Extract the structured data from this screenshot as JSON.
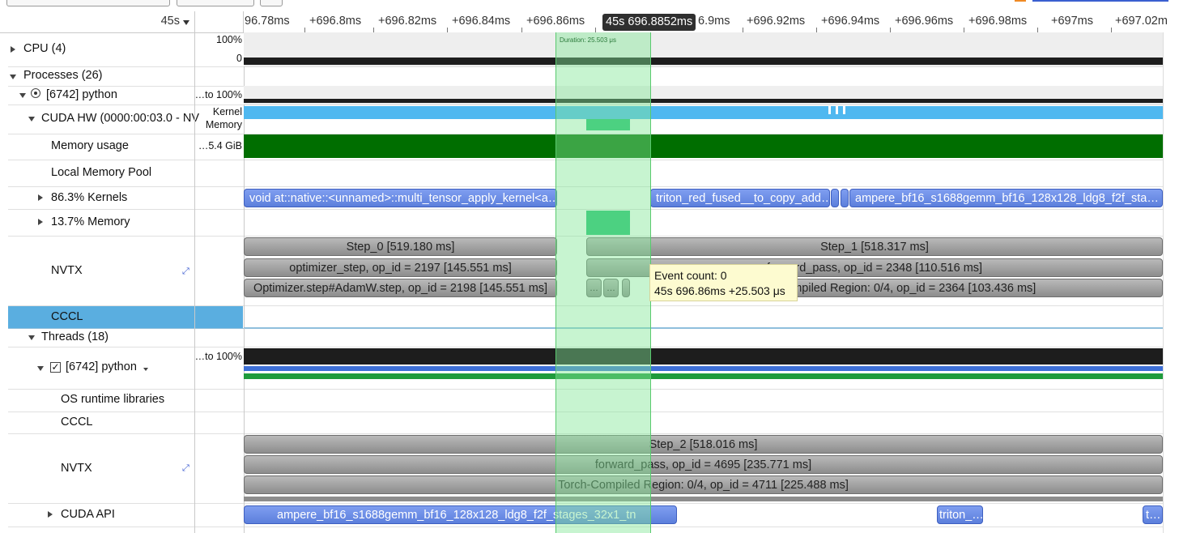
{
  "ruler": {
    "zoom_label": "45s",
    "ticks": [
      "96.78ms",
      "+696.8ms",
      "+696.82ms",
      "+696.84ms",
      "+696.86ms",
      "6.9ms",
      "+696.92ms",
      "+696.94ms",
      "+696.96ms",
      "+696.98ms",
      "+697ms",
      "+697.02m"
    ],
    "cursor_label": "45s 696.8852ms"
  },
  "selection": {
    "duration_label": "Duration: 25.503 μs"
  },
  "tree": {
    "cpu": {
      "label": "CPU (4)",
      "value_top": "100%",
      "value_bottom": "0"
    },
    "processes": {
      "label": "Processes (26)"
    },
    "python_proc": {
      "label": "[6742] python",
      "value": "…to 100%"
    },
    "cuda_hw": {
      "label": "CUDA HW (0000:00:03.0 - NV",
      "value_top": "Kernel",
      "value_bottom": "Memory"
    },
    "memory_usage": {
      "label": "Memory usage",
      "value": "…5.4 GiB"
    },
    "local_pool": {
      "label": "Local Memory Pool"
    },
    "kernels": {
      "label": "86.3% Kernels"
    },
    "memory": {
      "label": "13.7% Memory"
    },
    "nvtx": {
      "label": "NVTX"
    },
    "cccl": {
      "label": "CCCL"
    },
    "threads": {
      "label": "Threads (18)"
    },
    "thread_python": {
      "label": "[6742] python",
      "value": "…to 100%"
    },
    "os_runtime": {
      "label": "OS runtime libraries"
    },
    "cccl2": {
      "label": "CCCL"
    },
    "nvtx2": {
      "label": "NVTX"
    },
    "cuda_api": {
      "label": "CUDA API"
    }
  },
  "kernels_bars": [
    "void at::native::<unnamed>::multi_tensor_apply_kernel<a…",
    "triton_red_fused__to_copy_add…",
    "ampere_bf16_s1688gemm_bf16_128x128_ldg8_f2f_sta…"
  ],
  "nvtx_bars": {
    "step0": "Step_0 [519.180 ms]",
    "step1": "Step_1 [518.317 ms]",
    "opt_step": "optimizer_step, op_id = 2197 [145.551 ms]",
    "fwd_pass": "forward_pass, op_id = 2348 [110.516 ms]",
    "adamw": "Optimizer.step#AdamW.step, op_id = 2198 [145.551 ms]",
    "compiled": "Compiled Region: 0/4, op_id = 2364 [103.436 ms]",
    "dots": "…"
  },
  "tooltip": {
    "line1": "Event count: 0",
    "line2": "45s 696.86ms +25.503 μs"
  },
  "nvtx2_bars": {
    "step2": "Step_2 [518.016 ms]",
    "fwd_pass2": "forward_pass, op_id = 4695 [235.771 ms]",
    "compiled2": "Torch-Compiled Region: 0/4, op_id = 4711 [225.488 ms]"
  },
  "cuda_api_bars": [
    "ampere_bf16_s1688gemm_bf16_128x128_ldg8_f2f_stages_32x1_tn",
    "triton_…",
    "t…"
  ],
  "colors": {
    "kernel_blue": "#4fb8f0",
    "memory_green": "#006e00",
    "bar_blue": "#6a8be6",
    "selection_green": "#8fe6a0",
    "cccl_selected": "#5aaee0",
    "thread_green": "#1f9b3c",
    "thread_blue": "#3d6fd6"
  }
}
